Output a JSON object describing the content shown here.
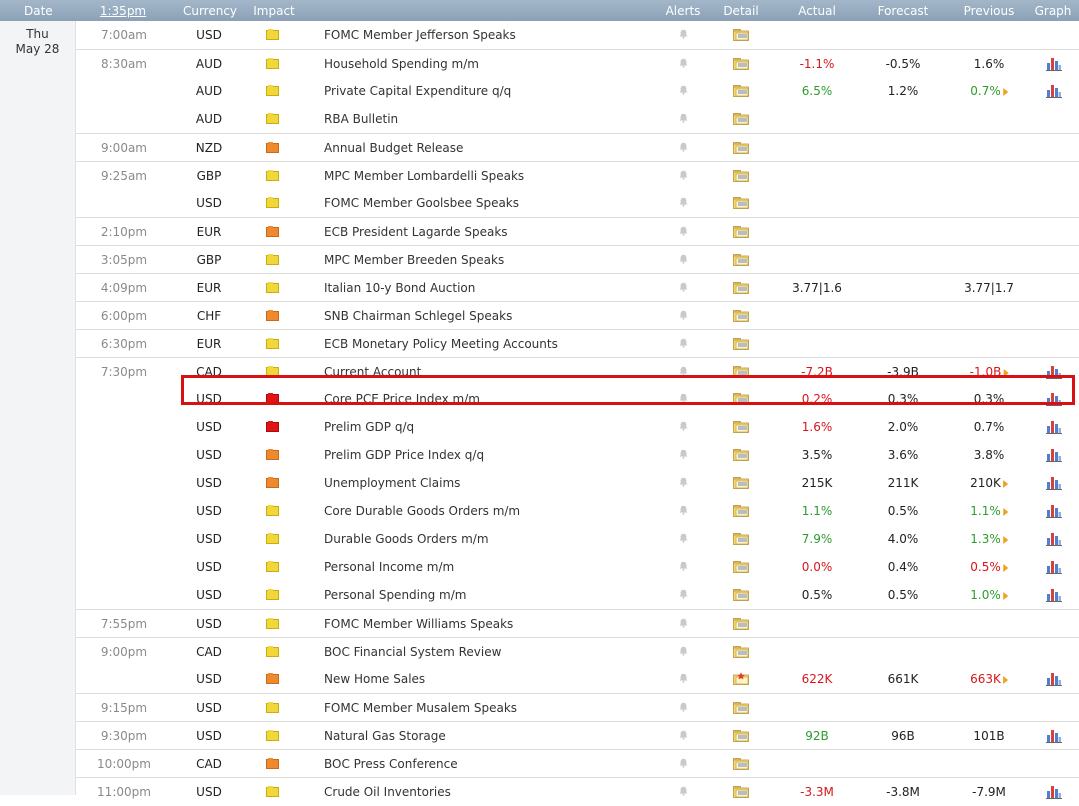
{
  "header": {
    "date": "Date",
    "time": "1:35pm",
    "currency": "Currency",
    "impact": "Impact",
    "alerts": "Alerts",
    "detail": "Detail",
    "actual": "Actual",
    "forecast": "Forecast",
    "previous": "Previous",
    "graph": "Graph"
  },
  "day": {
    "weekday": "Thu",
    "date": "May 28"
  },
  "rows": [
    {
      "time": "7:00am",
      "ccy": "USD",
      "impact": "low",
      "event": "FOMC Member Jefferson Speaks",
      "actual": "",
      "actual_color": "",
      "forecast": "",
      "previous": "",
      "previous_color": "",
      "prev_flag": false,
      "graph": false,
      "sep": false
    },
    {
      "time": "8:30am",
      "ccy": "AUD",
      "impact": "low",
      "event": "Household Spending m/m",
      "actual": "-1.1%",
      "actual_color": "red",
      "forecast": "-0.5%",
      "previous": "1.6%",
      "previous_color": "",
      "prev_flag": false,
      "graph": true,
      "sep": true
    },
    {
      "time": "",
      "ccy": "AUD",
      "impact": "low",
      "event": "Private Capital Expenditure q/q",
      "actual": "6.5%",
      "actual_color": "green",
      "forecast": "1.2%",
      "previous": "0.7%",
      "previous_color": "green",
      "prev_flag": true,
      "graph": true,
      "sep": false
    },
    {
      "time": "",
      "ccy": "AUD",
      "impact": "low",
      "event": "RBA Bulletin",
      "actual": "",
      "actual_color": "",
      "forecast": "",
      "previous": "",
      "previous_color": "",
      "prev_flag": false,
      "graph": false,
      "sep": false
    },
    {
      "time": "9:00am",
      "ccy": "NZD",
      "impact": "med",
      "event": "Annual Budget Release",
      "actual": "",
      "actual_color": "",
      "forecast": "",
      "previous": "",
      "previous_color": "",
      "prev_flag": false,
      "graph": false,
      "sep": true
    },
    {
      "time": "9:25am",
      "ccy": "GBP",
      "impact": "low",
      "event": "MPC Member Lombardelli Speaks",
      "actual": "",
      "actual_color": "",
      "forecast": "",
      "previous": "",
      "previous_color": "",
      "prev_flag": false,
      "graph": false,
      "sep": true
    },
    {
      "time": "",
      "ccy": "USD",
      "impact": "low",
      "event": "FOMC Member Goolsbee Speaks",
      "actual": "",
      "actual_color": "",
      "forecast": "",
      "previous": "",
      "previous_color": "",
      "prev_flag": false,
      "graph": false,
      "sep": false
    },
    {
      "time": "2:10pm",
      "ccy": "EUR",
      "impact": "med",
      "event": "ECB President Lagarde Speaks",
      "actual": "",
      "actual_color": "",
      "forecast": "",
      "previous": "",
      "previous_color": "",
      "prev_flag": false,
      "graph": false,
      "sep": true
    },
    {
      "time": "3:05pm",
      "ccy": "GBP",
      "impact": "low",
      "event": "MPC Member Breeden Speaks",
      "actual": "",
      "actual_color": "",
      "forecast": "",
      "previous": "",
      "previous_color": "",
      "prev_flag": false,
      "graph": false,
      "sep": true
    },
    {
      "time": "4:09pm",
      "ccy": "EUR",
      "impact": "low",
      "event": "Italian 10-y Bond Auction",
      "actual": "3.77|1.6",
      "actual_color": "",
      "forecast": "",
      "previous": "3.77|1.7",
      "previous_color": "",
      "prev_flag": false,
      "graph": false,
      "sep": true
    },
    {
      "time": "6:00pm",
      "ccy": "CHF",
      "impact": "med",
      "event": "SNB Chairman Schlegel Speaks",
      "actual": "",
      "actual_color": "",
      "forecast": "",
      "previous": "",
      "previous_color": "",
      "prev_flag": false,
      "graph": false,
      "sep": true
    },
    {
      "time": "6:30pm",
      "ccy": "EUR",
      "impact": "low",
      "event": "ECB Monetary Policy Meeting Accounts",
      "actual": "",
      "actual_color": "",
      "forecast": "",
      "previous": "",
      "previous_color": "",
      "prev_flag": false,
      "graph": false,
      "sep": true
    },
    {
      "time": "7:30pm",
      "ccy": "CAD",
      "impact": "low",
      "event": "Current Account",
      "actual": "-7.2B",
      "actual_color": "red",
      "forecast": "-3.9B",
      "previous": "-1.0B",
      "previous_color": "red",
      "prev_flag": true,
      "graph": true,
      "sep": true
    },
    {
      "time": "",
      "ccy": "USD",
      "impact": "high",
      "event": "Core PCE Price Index m/m",
      "actual": "0.2%",
      "actual_color": "red",
      "forecast": "0.3%",
      "previous": "0.3%",
      "previous_color": "",
      "prev_flag": false,
      "graph": true,
      "sep": false
    },
    {
      "time": "",
      "ccy": "USD",
      "impact": "high",
      "event": "Prelim GDP q/q",
      "actual": "1.6%",
      "actual_color": "red",
      "forecast": "2.0%",
      "previous": "0.7%",
      "previous_color": "",
      "prev_flag": false,
      "graph": true,
      "sep": false
    },
    {
      "time": "",
      "ccy": "USD",
      "impact": "med",
      "event": "Prelim GDP Price Index q/q",
      "actual": "3.5%",
      "actual_color": "",
      "forecast": "3.6%",
      "previous": "3.8%",
      "previous_color": "",
      "prev_flag": false,
      "graph": true,
      "sep": false
    },
    {
      "time": "",
      "ccy": "USD",
      "impact": "med",
      "event": "Unemployment Claims",
      "actual": "215K",
      "actual_color": "",
      "forecast": "211K",
      "previous": "210K",
      "previous_color": "",
      "prev_flag": true,
      "graph": true,
      "sep": false
    },
    {
      "time": "",
      "ccy": "USD",
      "impact": "low",
      "event": "Core Durable Goods Orders m/m",
      "actual": "1.1%",
      "actual_color": "green",
      "forecast": "0.5%",
      "previous": "1.1%",
      "previous_color": "green",
      "prev_flag": true,
      "graph": true,
      "sep": false
    },
    {
      "time": "",
      "ccy": "USD",
      "impact": "low",
      "event": "Durable Goods Orders m/m",
      "actual": "7.9%",
      "actual_color": "green",
      "forecast": "4.0%",
      "previous": "1.3%",
      "previous_color": "green",
      "prev_flag": true,
      "graph": true,
      "sep": false
    },
    {
      "time": "",
      "ccy": "USD",
      "impact": "low",
      "event": "Personal Income m/m",
      "actual": "0.0%",
      "actual_color": "red",
      "forecast": "0.4%",
      "previous": "0.5%",
      "previous_color": "red",
      "prev_flag": true,
      "graph": true,
      "sep": false
    },
    {
      "time": "",
      "ccy": "USD",
      "impact": "low",
      "event": "Personal Spending m/m",
      "actual": "0.5%",
      "actual_color": "",
      "forecast": "0.5%",
      "previous": "1.0%",
      "previous_color": "green",
      "prev_flag": true,
      "graph": true,
      "sep": false
    },
    {
      "time": "7:55pm",
      "ccy": "USD",
      "impact": "low",
      "event": "FOMC Member Williams Speaks",
      "actual": "",
      "actual_color": "",
      "forecast": "",
      "previous": "",
      "previous_color": "",
      "prev_flag": false,
      "graph": false,
      "sep": true
    },
    {
      "time": "9:00pm",
      "ccy": "CAD",
      "impact": "low",
      "event": "BOC Financial System Review",
      "actual": "",
      "actual_color": "",
      "forecast": "",
      "previous": "",
      "previous_color": "",
      "prev_flag": false,
      "graph": false,
      "sep": true
    },
    {
      "time": "",
      "ccy": "USD",
      "impact": "med",
      "event": "New Home Sales",
      "actual": "622K",
      "actual_color": "red",
      "forecast": "661K",
      "previous": "663K",
      "previous_color": "red",
      "prev_flag": true,
      "graph": true,
      "sep": false
    },
    {
      "time": "9:15pm",
      "ccy": "USD",
      "impact": "low",
      "event": "FOMC Member Musalem Speaks",
      "actual": "",
      "actual_color": "",
      "forecast": "",
      "previous": "",
      "previous_color": "",
      "prev_flag": false,
      "graph": false,
      "sep": true
    },
    {
      "time": "9:30pm",
      "ccy": "USD",
      "impact": "low",
      "event": "Natural Gas Storage",
      "actual": "92B",
      "actual_color": "green",
      "forecast": "96B",
      "previous": "101B",
      "previous_color": "",
      "prev_flag": false,
      "graph": true,
      "sep": true
    },
    {
      "time": "10:00pm",
      "ccy": "CAD",
      "impact": "med",
      "event": "BOC Press Conference",
      "actual": "",
      "actual_color": "",
      "forecast": "",
      "previous": "",
      "previous_color": "",
      "prev_flag": false,
      "graph": false,
      "sep": true
    },
    {
      "time": "11:00pm",
      "ccy": "USD",
      "impact": "low",
      "event": "Crude Oil Inventories",
      "actual": "-3.3M",
      "actual_color": "red",
      "forecast": "-3.8M",
      "previous": "-7.9M",
      "previous_color": "",
      "prev_flag": false,
      "graph": true,
      "sep": true
    }
  ],
  "highlighted_event": "Core PCE Price Index m/m",
  "colors": {
    "header": "#97abbf",
    "highlight": "#d90f12",
    "red_value": "#d8161b",
    "green_value": "#2e9c2e"
  }
}
